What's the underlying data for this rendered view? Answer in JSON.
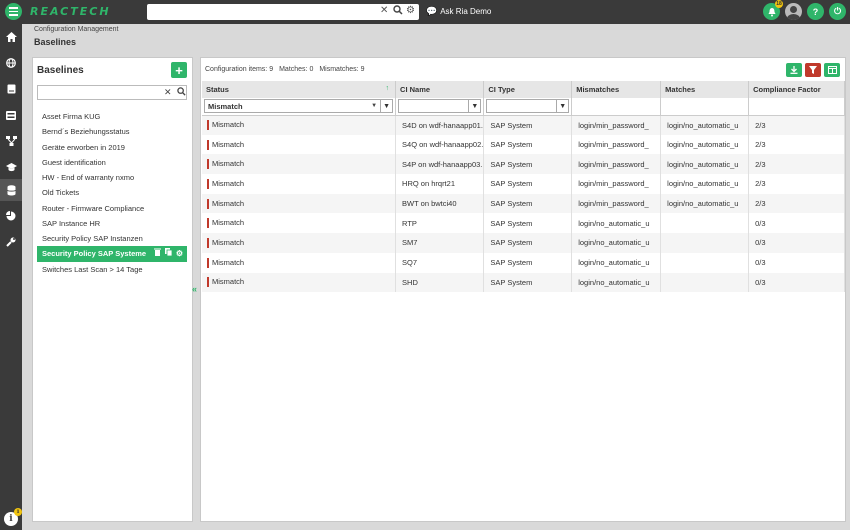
{
  "app": {
    "logo": "REACTECH"
  },
  "topbar": {
    "ask_ria": "Ask Ria Demo",
    "notif_count": "18"
  },
  "header": {
    "breadcrumb": "Configuration Management",
    "title": "Baselines"
  },
  "baselines": {
    "title": "Baselines",
    "items": [
      "Asset Firma KUG",
      "Bernd´s Beziehungsstatus",
      "Geräte erworben in 2019",
      "Guest identification",
      "HW - End of warranty nxmo",
      "Old Tickets",
      "Router - Firmware Compliance",
      "SAP Instance HR",
      "Security Policy SAP Instanzen",
      "Security Policy SAP Systeme",
      "Switches Last Scan > 14 Tage"
    ],
    "selected_index": 9
  },
  "summary": {
    "config_items": "Configuration items: 9",
    "matches": "Matches: 0",
    "mismatches": "Mismatches: 9"
  },
  "table": {
    "columns": [
      "Status",
      "CI Name",
      "CI Type",
      "Mismatches",
      "Matches",
      "Compliance Factor"
    ],
    "status_filter": "Mismatch",
    "rows": [
      [
        "Mismatch",
        "S4D on wdf-hanaapp01.",
        "SAP System",
        "login/min_password_",
        "login/no_automatic_u",
        "2/3"
      ],
      [
        "Mismatch",
        "S4Q on wdf-hanaapp02.",
        "SAP System",
        "login/min_password_",
        "login/no_automatic_u",
        "2/3"
      ],
      [
        "Mismatch",
        "S4P on wdf-hanaapp03.",
        "SAP System",
        "login/min_password_",
        "login/no_automatic_u",
        "2/3"
      ],
      [
        "Mismatch",
        "HRQ on hrqrt21",
        "SAP System",
        "login/min_password_",
        "login/no_automatic_u",
        "2/3"
      ],
      [
        "Mismatch",
        "BWT on bwtci40",
        "SAP System",
        "login/min_password_",
        "login/no_automatic_u",
        "2/3"
      ],
      [
        "Mismatch",
        "RTP",
        "SAP System",
        "login/no_automatic_u",
        "",
        "0/3"
      ],
      [
        "Mismatch",
        "SM7",
        "SAP System",
        "login/no_automatic_u",
        "",
        "0/3"
      ],
      [
        "Mismatch",
        "SQ7",
        "SAP System",
        "login/no_automatic_u",
        "",
        "0/3"
      ],
      [
        "Mismatch",
        "SHD",
        "SAP System",
        "login/no_automatic_u",
        "",
        "0/3"
      ]
    ]
  },
  "colors": {
    "accent": "#2fb56a",
    "mismatch": "#c0392b",
    "dark": "#3a3a3a"
  }
}
